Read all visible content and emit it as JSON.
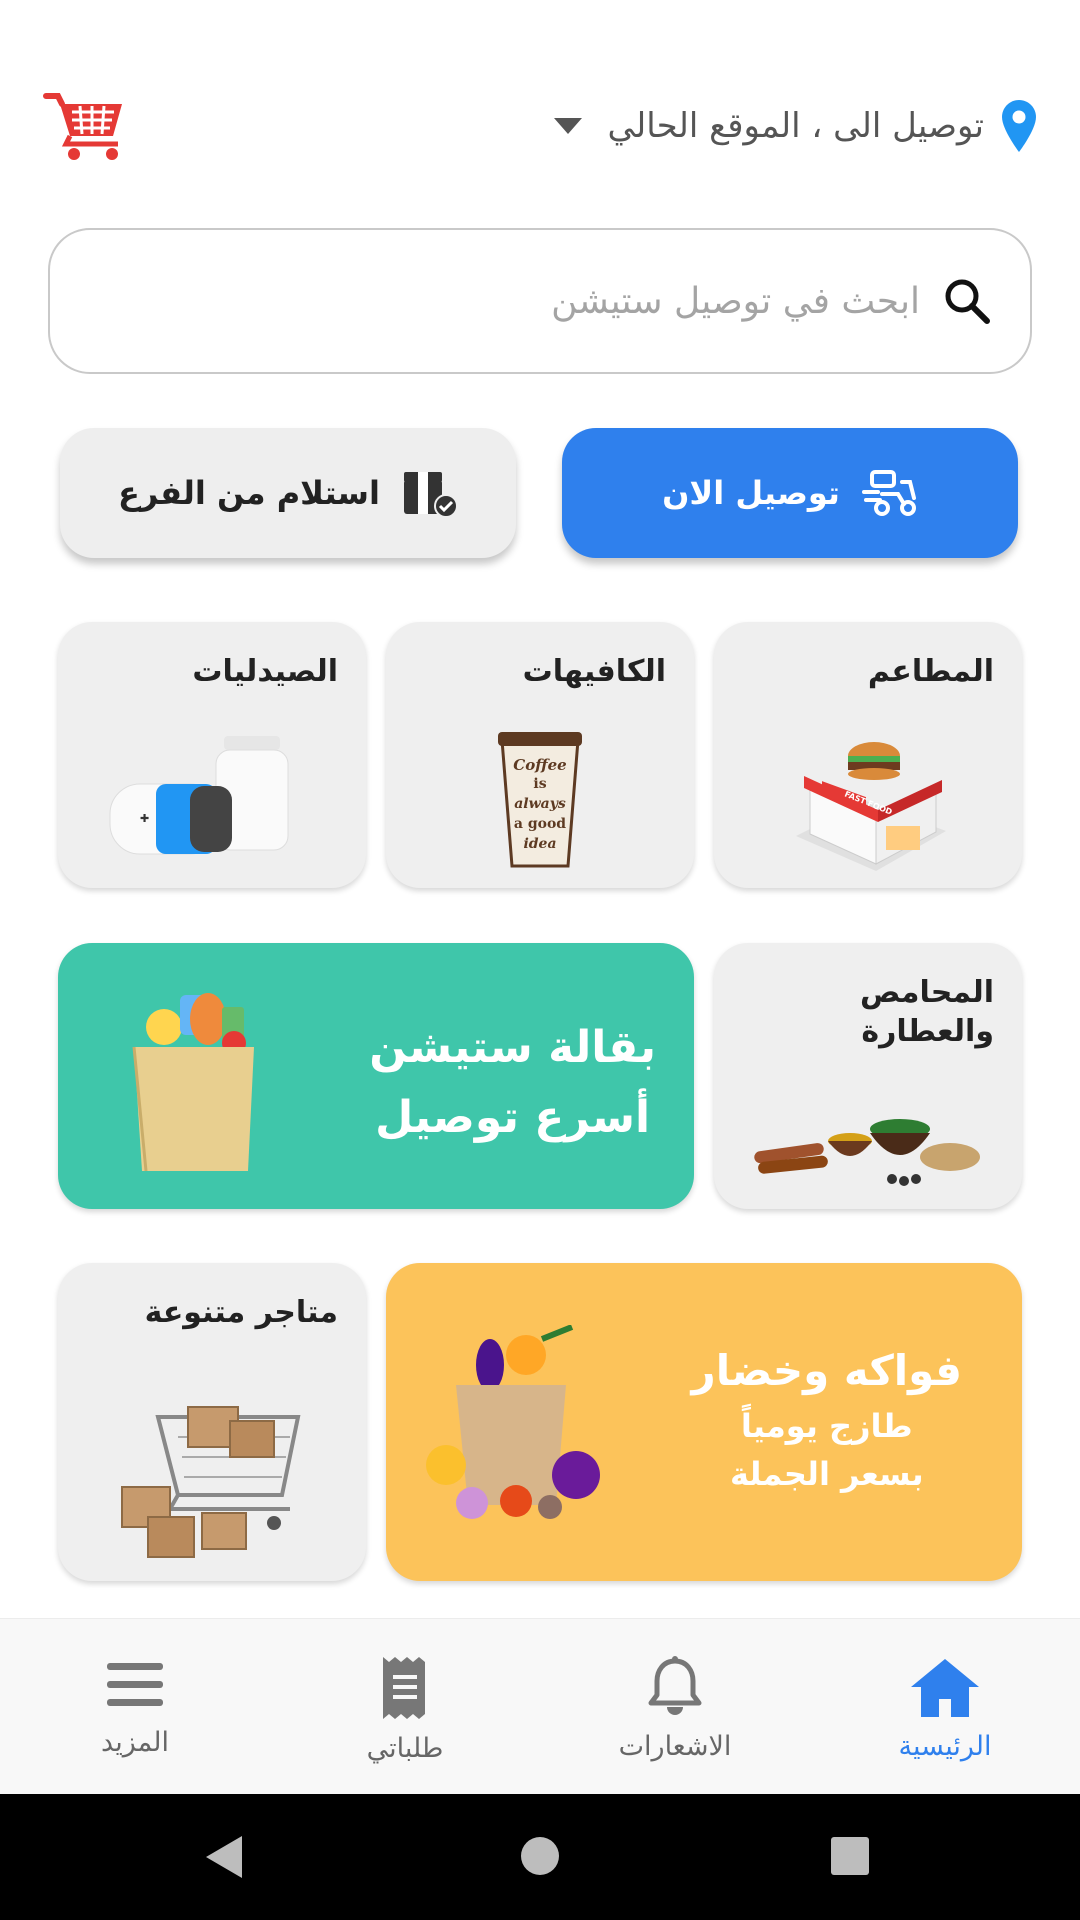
{
  "header": {
    "location_label": "توصيل الى ، الموقع الحالي",
    "colors": {
      "pin": "#2196f3",
      "cart": "#e53935"
    }
  },
  "search": {
    "placeholder": "ابحث في توصيل ستيشن"
  },
  "delivery_modes": {
    "deliver_now": "توصيل الان",
    "pickup": "استلام من الفرع"
  },
  "categories": {
    "restaurants": "المطاعم",
    "cafes": "الكافيهات",
    "pharmacies": "الصيدليات",
    "roasteries_line1": "المحامص",
    "roasteries_line2": "والعطارة",
    "misc_stores": "متاجر متنوعة"
  },
  "grocery_banner": {
    "line1": "بقالة ستيشن",
    "line2": "أسرع توصيل",
    "color": "#3fc6aa"
  },
  "fruit_banner": {
    "line1": "فواكه وخضار",
    "line2": "طازج يومياً",
    "line3": "بسعر الجملة",
    "color": "#fcc35a"
  },
  "coffee_cup_text": [
    "Coffee",
    "is",
    "always",
    "a good",
    "idea"
  ],
  "fast_food_sign": "FAST FOOD",
  "bottom_nav": [
    {
      "label": "الرئيسية",
      "icon": "home-icon",
      "active": true
    },
    {
      "label": "الاشعارات",
      "icon": "bell-icon",
      "active": false
    },
    {
      "label": "طلباتي",
      "icon": "receipt-icon",
      "active": false
    },
    {
      "label": "المزيد",
      "icon": "menu-icon",
      "active": false
    }
  ],
  "accent_color": "#2f80ed"
}
